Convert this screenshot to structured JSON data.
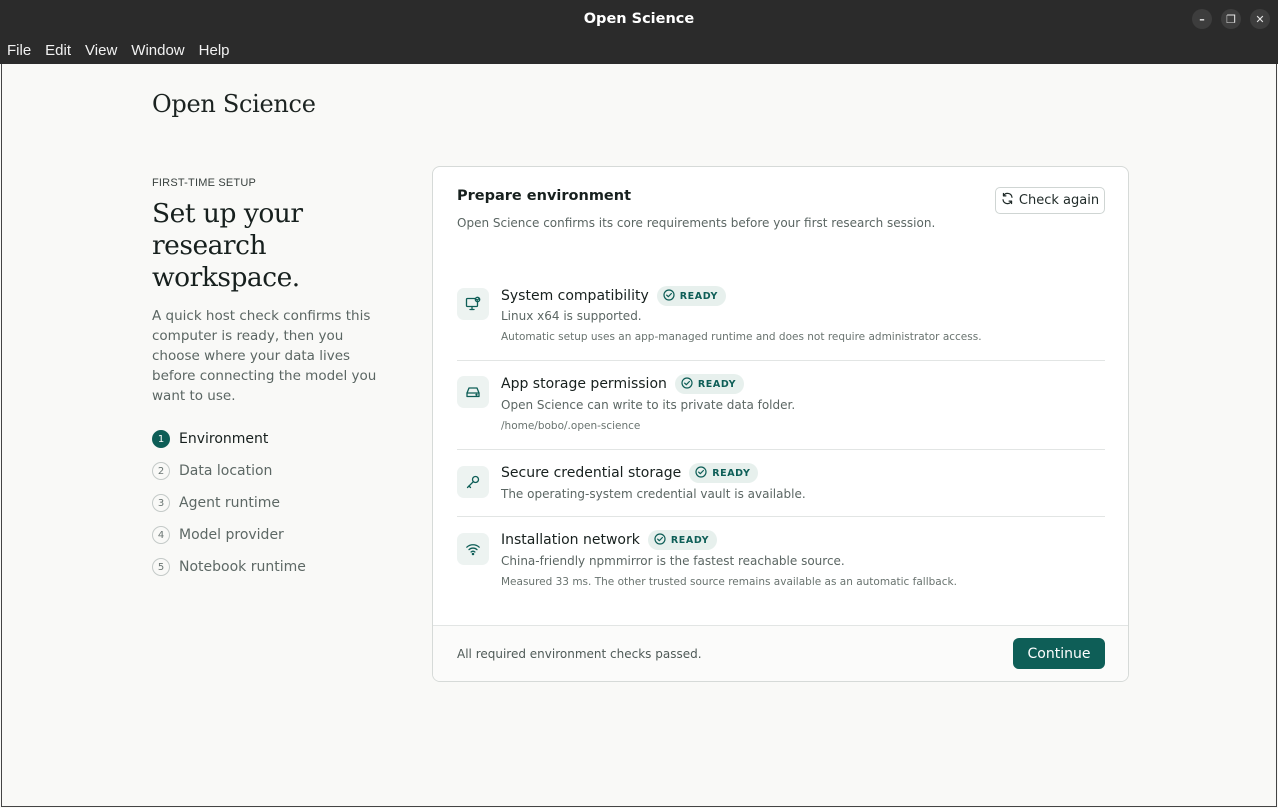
{
  "window": {
    "title": "Open Science",
    "controls": {
      "minimize": "–",
      "restore": "❐",
      "close": "✕"
    }
  },
  "menu": [
    "File",
    "Edit",
    "View",
    "Window",
    "Help"
  ],
  "brand": "Open Science",
  "intro": {
    "kicker": "FIRST-TIME SETUP",
    "headline": "Set up your research workspace.",
    "description": "A quick host check confirms this computer is ready, then you choose where your data lives before connecting the model you want to use."
  },
  "steps": [
    {
      "num": "1",
      "label": "Environment",
      "active": true
    },
    {
      "num": "2",
      "label": "Data location",
      "active": false
    },
    {
      "num": "3",
      "label": "Agent runtime",
      "active": false
    },
    {
      "num": "4",
      "label": "Model provider",
      "active": false
    },
    {
      "num": "5",
      "label": "Notebook runtime",
      "active": false
    }
  ],
  "card": {
    "title": "Prepare environment",
    "subtitle": "Open Science confirms its core requirements before your first research session.",
    "check_again": "Check again",
    "requirements": [
      {
        "title": "System compatibility",
        "badge": "READY",
        "icon": "monitor-check-icon",
        "description": "Linux x64 is supported.",
        "detail": "Automatic setup uses an app-managed runtime and does not require administrator access."
      },
      {
        "title": "App storage permission",
        "badge": "READY",
        "icon": "hard-drive-icon",
        "description": "Open Science can write to its private data folder.",
        "detail": "/home/bobo/.open-science"
      },
      {
        "title": "Secure credential storage",
        "badge": "READY",
        "icon": "key-icon",
        "description": "The operating-system credential vault is available."
      },
      {
        "title": "Installation network",
        "badge": "READY",
        "icon": "wifi-icon",
        "description": "China-friendly npmmirror is the fastest reachable source.",
        "detail": "Measured 33 ms. The other trusted source remains available as an automatic fallback."
      }
    ],
    "footer_status": "All required environment checks passed.",
    "continue": "Continue"
  },
  "colors": {
    "accent": "#0e5e57",
    "badge_bg": "#e7f0ed",
    "titlebar": "#2b2b2b",
    "background": "#f9f9f7"
  }
}
